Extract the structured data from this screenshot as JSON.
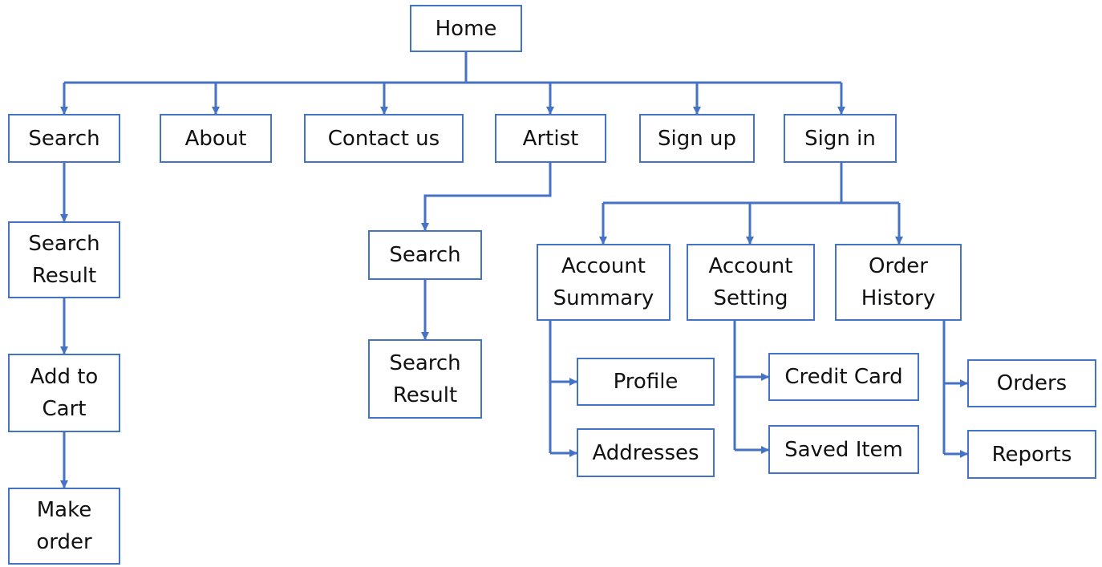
{
  "colors": {
    "line": "#4472c4",
    "box_border": "#4472c4",
    "text": "#111111",
    "background": "#ffffff"
  },
  "nodes": {
    "home": "Home",
    "search": "Search",
    "about": "About",
    "contact_us": "Contact us",
    "artist": "Artist",
    "sign_up": "Sign up",
    "sign_in": "Sign in",
    "search_result": "Search\nResult",
    "add_to_cart": "Add to\nCart",
    "make_order": "Make\norder",
    "artist_search": "Search",
    "artist_search_result": "Search\nResult",
    "account_summary": "Account\nSummary",
    "account_setting": "Account\nSetting",
    "order_history": "Order\nHistory",
    "profile": "Profile",
    "addresses": "Addresses",
    "credit_card": "Credit Card",
    "saved_item": "Saved Item",
    "orders": "Orders",
    "reports": "Reports"
  }
}
